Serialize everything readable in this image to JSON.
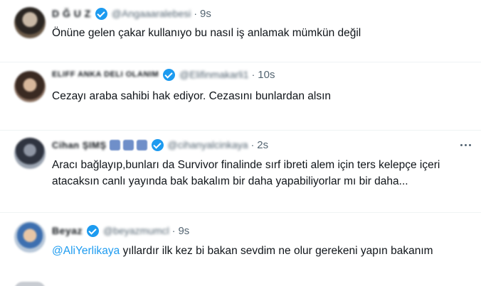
{
  "tweets": [
    {
      "name": "D Ğ U Z",
      "handle": "@Angaaaralebesi",
      "time": "9s",
      "text": "Önüne gelen çakar kullanıyo bu nasıl iş anlamak mümkün değil"
    },
    {
      "name": "ELIFF ANKA DELI OLANIM",
      "handle": "@Elifinmakarli1",
      "time": "10s",
      "text": "Cezayı araba sahibi hak ediyor. Cezasını bunlardan alsın"
    },
    {
      "name": "Cihan ŞIMŞ",
      "handle": "@cihanyalcinkaya",
      "time": "2s",
      "text": "Aracı bağlayıp,bunları da Survivor finalinde sırf ibreti alem için ters kelepçe içeri atacaksın canlı yayında bak bakalım bir daha yapabiliyorlar mı bir daha..."
    },
    {
      "name": "Beyaz",
      "handle": "@beyazmumcl",
      "time": "9s",
      "mention": "@AliYerlikaya",
      "text": " yıllardır ilk kez bi bakan sevdim ne olur gerekeni yapın bakanım"
    }
  ],
  "separator": "·",
  "icons": {
    "verified": "verified-badge-icon",
    "more": "more-options-icon"
  },
  "colors": {
    "accent": "#1d9bf0",
    "muted": "#536471",
    "text": "#0f1419"
  }
}
